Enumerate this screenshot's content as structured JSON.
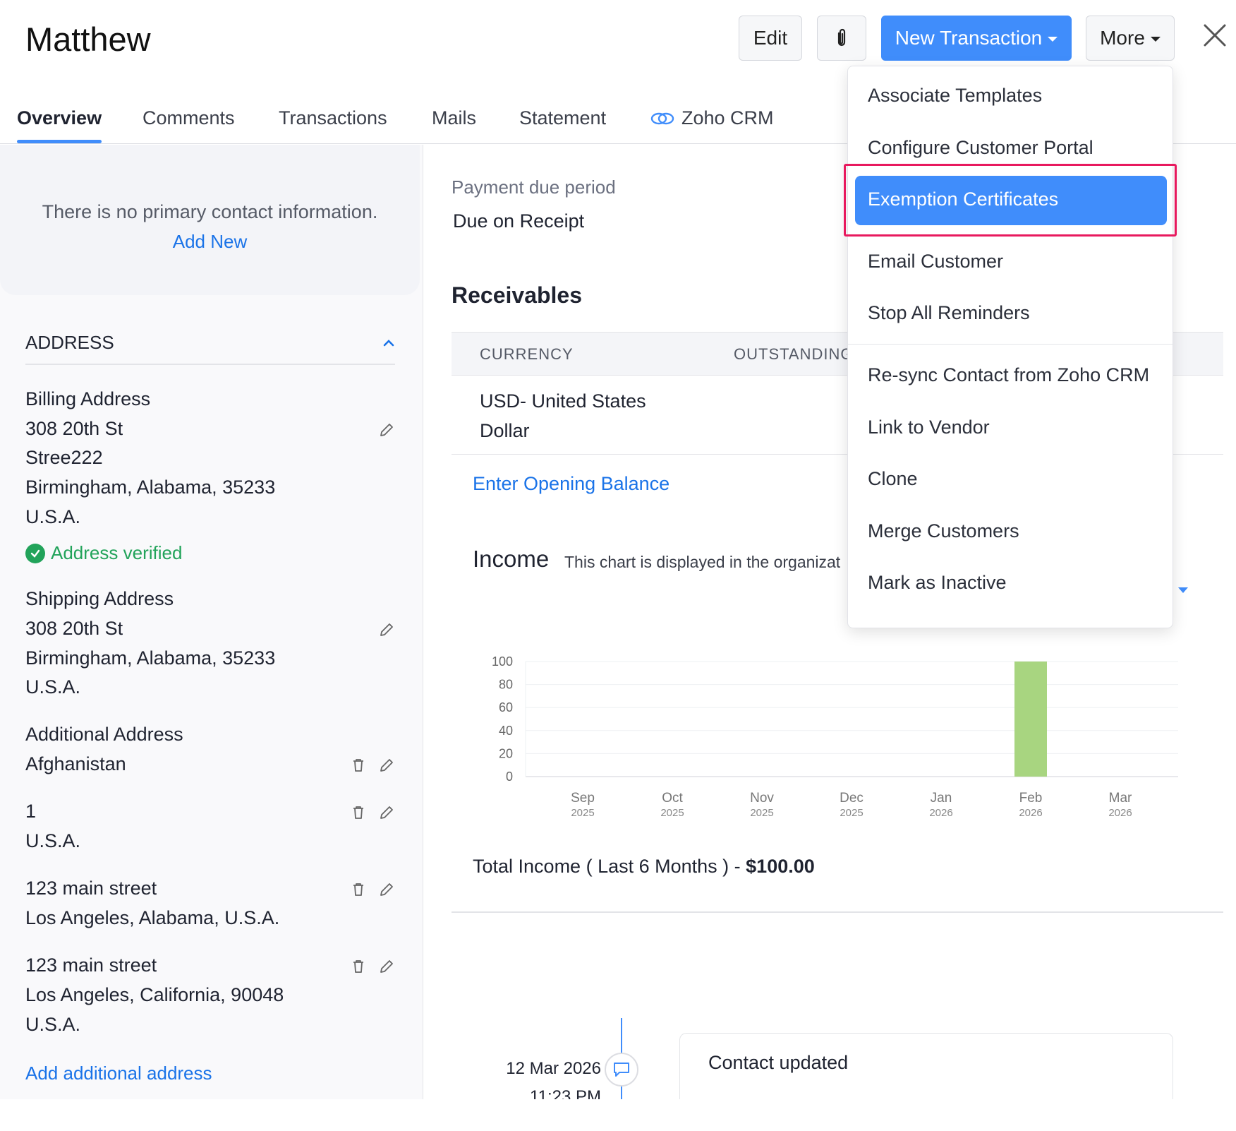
{
  "header": {
    "title": "Matthew",
    "edit_label": "Edit",
    "attach_icon": "paperclip-icon",
    "new_transaction_label": "New Transaction",
    "more_label": "More",
    "close_icon": "close-icon"
  },
  "tabs": [
    {
      "label": "Overview",
      "active": true
    },
    {
      "label": "Comments"
    },
    {
      "label": "Transactions"
    },
    {
      "label": "Mails"
    },
    {
      "label": "Statement"
    },
    {
      "label": "Zoho CRM",
      "icon": "zoho-crm-icon"
    }
  ],
  "left": {
    "contact_message": "There is no primary contact information.",
    "add_new": "Add New",
    "address_section": "ADDRESS",
    "billing": {
      "heading": "Billing Address",
      "lines": [
        "308 20th St",
        "Stree222",
        "Birmingham, Alabama, 35233",
        "U.S.A."
      ],
      "verified": "Address verified"
    },
    "shipping": {
      "heading": "Shipping Address",
      "lines": [
        "308 20th St",
        "Birmingham, Alabama, 35233",
        "U.S.A."
      ]
    },
    "additional": {
      "heading": "Additional Address",
      "entries": [
        {
          "lines": [
            "Afghanistan"
          ]
        },
        {
          "lines": [
            "1",
            "U.S.A."
          ]
        },
        {
          "lines": [
            "123 main street",
            "Los Angeles, Alabama, U.S.A."
          ]
        },
        {
          "lines": [
            "123 main street",
            "Los Angeles, California, 90048",
            "U.S.A."
          ]
        }
      ]
    },
    "add_additional": "Add additional address"
  },
  "main": {
    "payment_due_label": "Payment due period",
    "payment_due_value": "Due on Receipt",
    "receivables_title": "Receivables",
    "table": {
      "headers": [
        "CURRENCY",
        "OUTSTANDING"
      ],
      "rows": [
        {
          "currency_line1": "USD- United States",
          "currency_line2": "Dollar"
        }
      ]
    },
    "opening_balance": "Enter Opening Balance",
    "income_title": "Income",
    "income_note": "This chart is displayed in the organizat",
    "total_prefix": "Total Income ( Last 6 Months ) - ",
    "total_value": "$100.00"
  },
  "chart_data": {
    "type": "bar",
    "categories": [
      "Sep 2025",
      "Oct 2025",
      "Nov 2025",
      "Dec 2025",
      "Jan 2026",
      "Feb 2026",
      "Mar 2026"
    ],
    "month_labels": [
      "Sep",
      "Oct",
      "Nov",
      "Dec",
      "Jan",
      "Feb",
      "Mar"
    ],
    "year_labels": [
      "2025",
      "2025",
      "2025",
      "2025",
      "2026",
      "2026",
      "2026"
    ],
    "values": [
      0,
      0,
      0,
      0,
      0,
      100,
      0
    ],
    "yticks": [
      "100",
      "80",
      "60",
      "40",
      "20",
      "0"
    ],
    "ylim": [
      0,
      100
    ],
    "bar_color": "#a8d580",
    "grid": true
  },
  "timeline": {
    "date": "12 Mar 2026",
    "time": "11:23 PM",
    "event": "Contact updated",
    "icon": "comment-icon"
  },
  "more_menu": {
    "items": [
      "Associate Templates",
      "Configure Customer Portal",
      "Exemption Certificates",
      "Email Customer",
      "Stop All Reminders",
      "Re-sync Contact from Zoho CRM",
      "Link to Vendor",
      "Clone",
      "Merge Customers",
      "Mark as Inactive"
    ],
    "selected": "Exemption Certificates"
  },
  "colors": {
    "accent": "#408dfb",
    "link": "#1a73e8",
    "verified": "#22a35a",
    "highlight": "#e8195e"
  }
}
